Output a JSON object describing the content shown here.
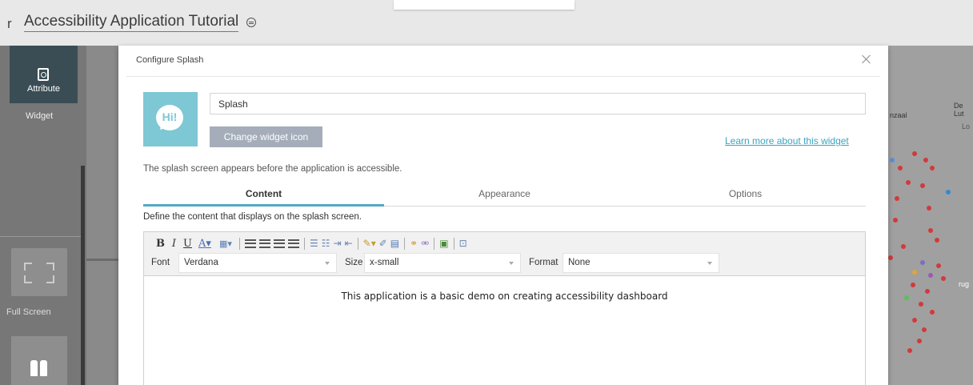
{
  "header": {
    "lead_char": "r",
    "app_title": "Accessibility Application Tutorial"
  },
  "left_panel": {
    "attribute_label": "Attribute",
    "widget_label": "Widget",
    "fullscreen_label": "Full Screen"
  },
  "dialog": {
    "title": "Configure Splash",
    "widget_icon_text": "Hi!",
    "name_value": "Splash",
    "change_icon_label": "Change widget icon",
    "learn_more_label": "Learn more about this widget",
    "description": "The splash screen appears before the application is accessible.",
    "tabs": [
      {
        "label": "Content",
        "active": true
      },
      {
        "label": "Appearance",
        "active": false
      },
      {
        "label": "Options",
        "active": false
      }
    ],
    "define_text": "Define the content that displays on the splash screen.",
    "editor": {
      "font_label": "Font",
      "font_value": "Verdana",
      "size_label": "Size",
      "size_value": "x-small",
      "format_label": "Format",
      "format_value": "None",
      "content": "This application is a basic demo on creating accessibility dashboard"
    }
  },
  "map": {
    "labels": [
      "De Lut",
      "nzaal",
      "Lo",
      "rug"
    ]
  },
  "colors": {
    "accent": "#52a9c2",
    "link": "#3aa5c1",
    "icon_bg": "#7ec7d4",
    "button_bg": "#a4adb9",
    "attribute_tile": "#3a4d54"
  }
}
